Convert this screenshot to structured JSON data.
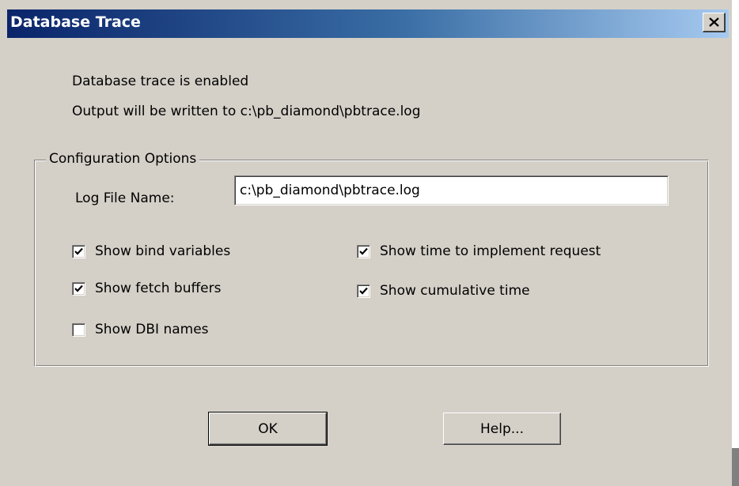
{
  "window": {
    "title": "Database Trace",
    "close_glyph": "✕"
  },
  "status": {
    "line1": "Database trace is enabled",
    "line2": "Output will be written to c:\\pb_diamond\\pbtrace.log"
  },
  "config": {
    "group_label": "Configuration Options",
    "log_file_label": "Log File Name:",
    "log_file_value": "c:\\pb_diamond\\pbtrace.log",
    "options": [
      {
        "label": "Show bind variables",
        "checked": true
      },
      {
        "label": "Show fetch buffers",
        "checked": true
      },
      {
        "label": "Show DBI names",
        "checked": false
      },
      {
        "label": "Show time to implement request",
        "checked": true
      },
      {
        "label": "Show cumulative time",
        "checked": true
      }
    ]
  },
  "buttons": {
    "ok_label": "OK",
    "help_label": "Help..."
  },
  "colors": {
    "dialog_face": "#d4d0c8",
    "title_start": "#0a246a",
    "title_end": "#a6caf0"
  }
}
